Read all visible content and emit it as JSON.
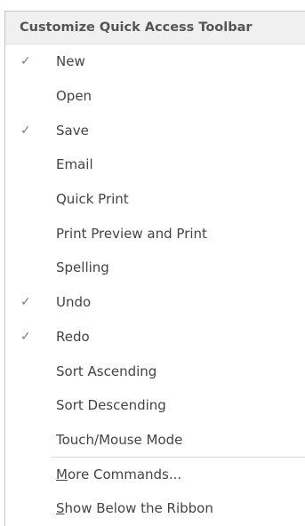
{
  "menu": {
    "title": "Customize Quick Access Toolbar",
    "items": [
      {
        "label": "New",
        "checked": true
      },
      {
        "label": "Open",
        "checked": false
      },
      {
        "label": "Save",
        "checked": true
      },
      {
        "label": "Email",
        "checked": false
      },
      {
        "label": "Quick Print",
        "checked": false
      },
      {
        "label": "Print Preview and Print",
        "checked": false
      },
      {
        "label": "Spelling",
        "checked": false
      },
      {
        "label": "Undo",
        "checked": true
      },
      {
        "label": "Redo",
        "checked": true
      },
      {
        "label": "Sort Ascending",
        "checked": false
      },
      {
        "label": "Sort Descending",
        "checked": false
      },
      {
        "label": "Touch/Mouse Mode",
        "checked": false
      }
    ],
    "check_glyph": "✓",
    "commands": [
      {
        "accel": "M",
        "rest": "ore Commands..."
      },
      {
        "accel": "S",
        "rest": "how Below the Ribbon"
      }
    ]
  }
}
